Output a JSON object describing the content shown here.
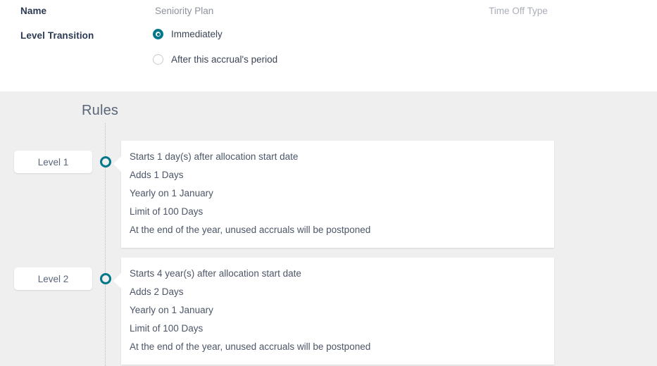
{
  "form": {
    "name_label": "Name",
    "name_value": "Seniority Plan",
    "time_off_type_label": "Time Off Type",
    "level_transition_label": "Level Transition",
    "transition_options": [
      {
        "label": "Immediately",
        "selected": true
      },
      {
        "label": "After this accrual's period",
        "selected": false
      }
    ]
  },
  "rules": {
    "title": "Rules",
    "levels": [
      {
        "badge": "Level 1",
        "lines": [
          "Starts 1 day(s) after allocation start date",
          "Adds 1 Days",
          "Yearly on 1 January",
          "Limit of 100 Days",
          "At the end of the year, unused accruals will be postponed"
        ]
      },
      {
        "badge": "Level 2",
        "lines": [
          "Starts 4 year(s) after allocation start date",
          "Adds 2 Days",
          "Yearly on 1 January",
          "Limit of 100 Days",
          "At the end of the year, unused accruals will be postponed"
        ]
      }
    ]
  },
  "colors": {
    "accent_teal": "#00788a",
    "page_gray": "#efefef",
    "text_dark": "#2b3a52",
    "text_muted": "#8c919b"
  }
}
